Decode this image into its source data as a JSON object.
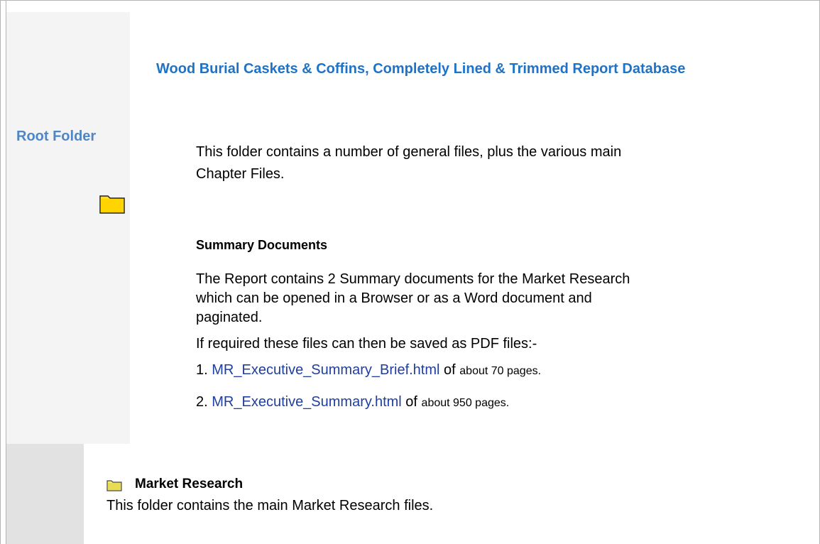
{
  "header": {
    "title": "Wood Burial Caskets & Coffins, Completely Lined & Trimmed Report Database"
  },
  "sidebar": {
    "root_label": "Root Folder",
    "folder_icon": "folder-icon"
  },
  "intro": {
    "text": "This folder contains a number of general files, plus the various main Chapter Files."
  },
  "summary": {
    "heading": "Summary Documents",
    "description": "The Report contains 2 Summary documents for the Market Research which can be opened in a Browser or as a Word document and paginated.",
    "pdf_note": "If required these files can then be saved as PDF files:-",
    "documents": [
      {
        "number": "1.",
        "link": "MR_Executive_Summary_Brief.html",
        "of_label": "of",
        "pages": "about 70 pages."
      },
      {
        "number": "2.",
        "link": "MR_Executive_Summary.html",
        "of_label": "of",
        "pages": "about 950 pages."
      }
    ]
  },
  "market_research": {
    "heading": "Market Research",
    "description": "This folder contains the main Market Research files.",
    "icon": "folder-icon"
  },
  "colors": {
    "title_blue": "#1f72c5",
    "root_blue": "#4f86c6",
    "link_blue": "#1f3f9e",
    "folder_yellow": "#ffd700",
    "panel_gray": "#f4f4f4"
  }
}
